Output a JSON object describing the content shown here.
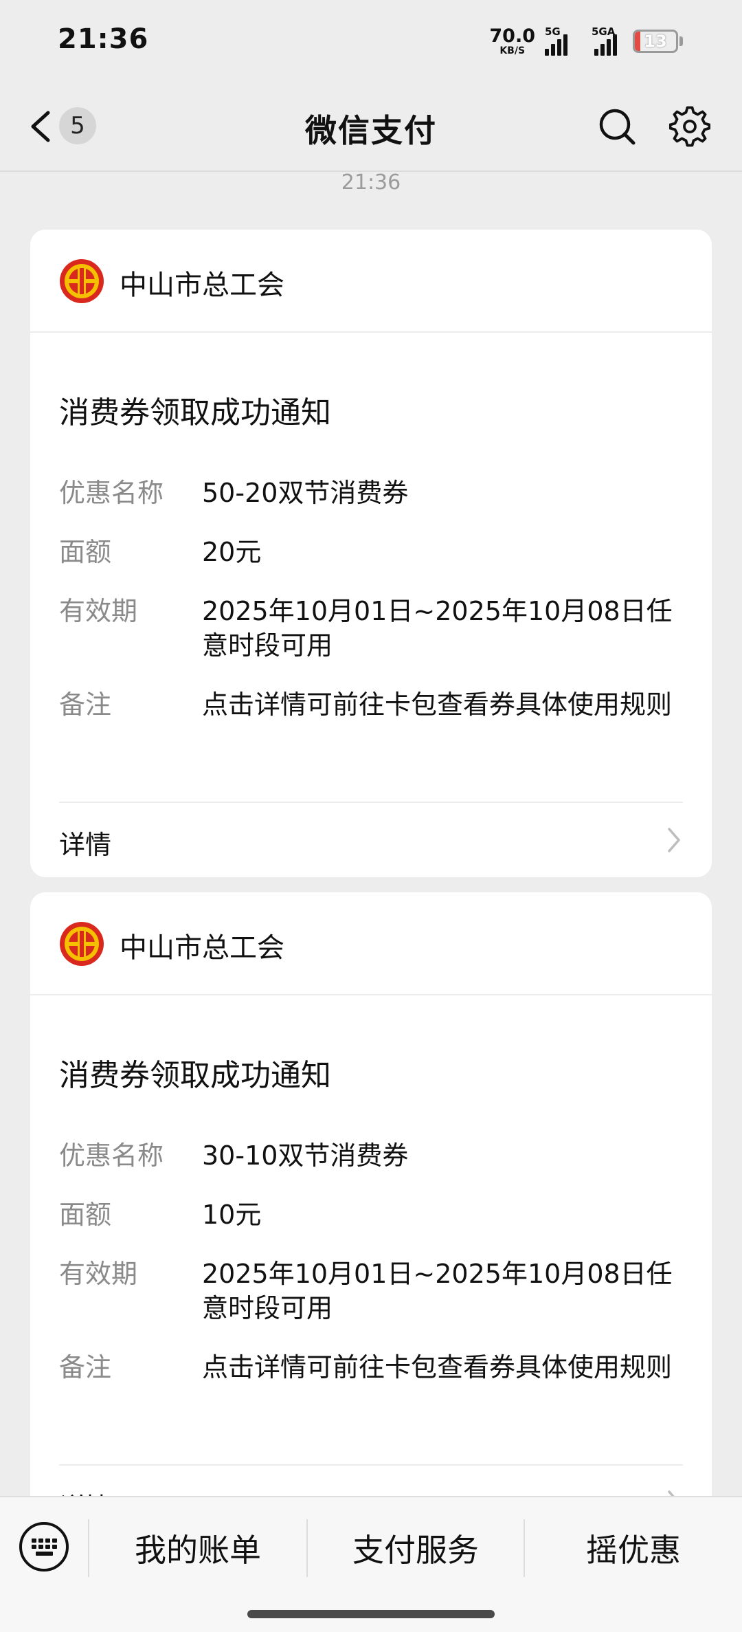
{
  "status_bar": {
    "time": "21:36",
    "net_speed_value": "70.0",
    "net_speed_unit": "KB/S",
    "sim1_label": "5G",
    "sim2_label": "5GA",
    "battery_level": "13",
    "battery_color": "#e34b45"
  },
  "nav": {
    "back_count": "5",
    "title": "微信支付"
  },
  "timestamp": "21:36",
  "cards": [
    {
      "org_name": "中山市总工会",
      "title": "消费券领取成功通知",
      "fields": [
        {
          "key": "优惠名称",
          "value": "50-20双节消费券"
        },
        {
          "key": "面额",
          "value": "20元"
        },
        {
          "key": "有效期",
          "value": "2025年10月01日~2025年10月08日任意时段可用"
        },
        {
          "key": "备注",
          "value": "点击详情可前往卡包查看券具体使用规则"
        }
      ],
      "details_label": "详情"
    },
    {
      "org_name": "中山市总工会",
      "title": "消费券领取成功通知",
      "fields": [
        {
          "key": "优惠名称",
          "value": "30-10双节消费券"
        },
        {
          "key": "面额",
          "value": "10元"
        },
        {
          "key": "有效期",
          "value": "2025年10月01日~2025年10月08日任意时段可用"
        },
        {
          "key": "备注",
          "value": "点击详情可前往卡包查看券具体使用规则"
        }
      ],
      "details_label": "详情"
    }
  ],
  "bottom_menu": {
    "items": [
      "我的账单",
      "支付服务",
      "摇优惠"
    ]
  },
  "colors": {
    "logo_red": "#d9281e",
    "logo_yellow": "#f5c000"
  }
}
